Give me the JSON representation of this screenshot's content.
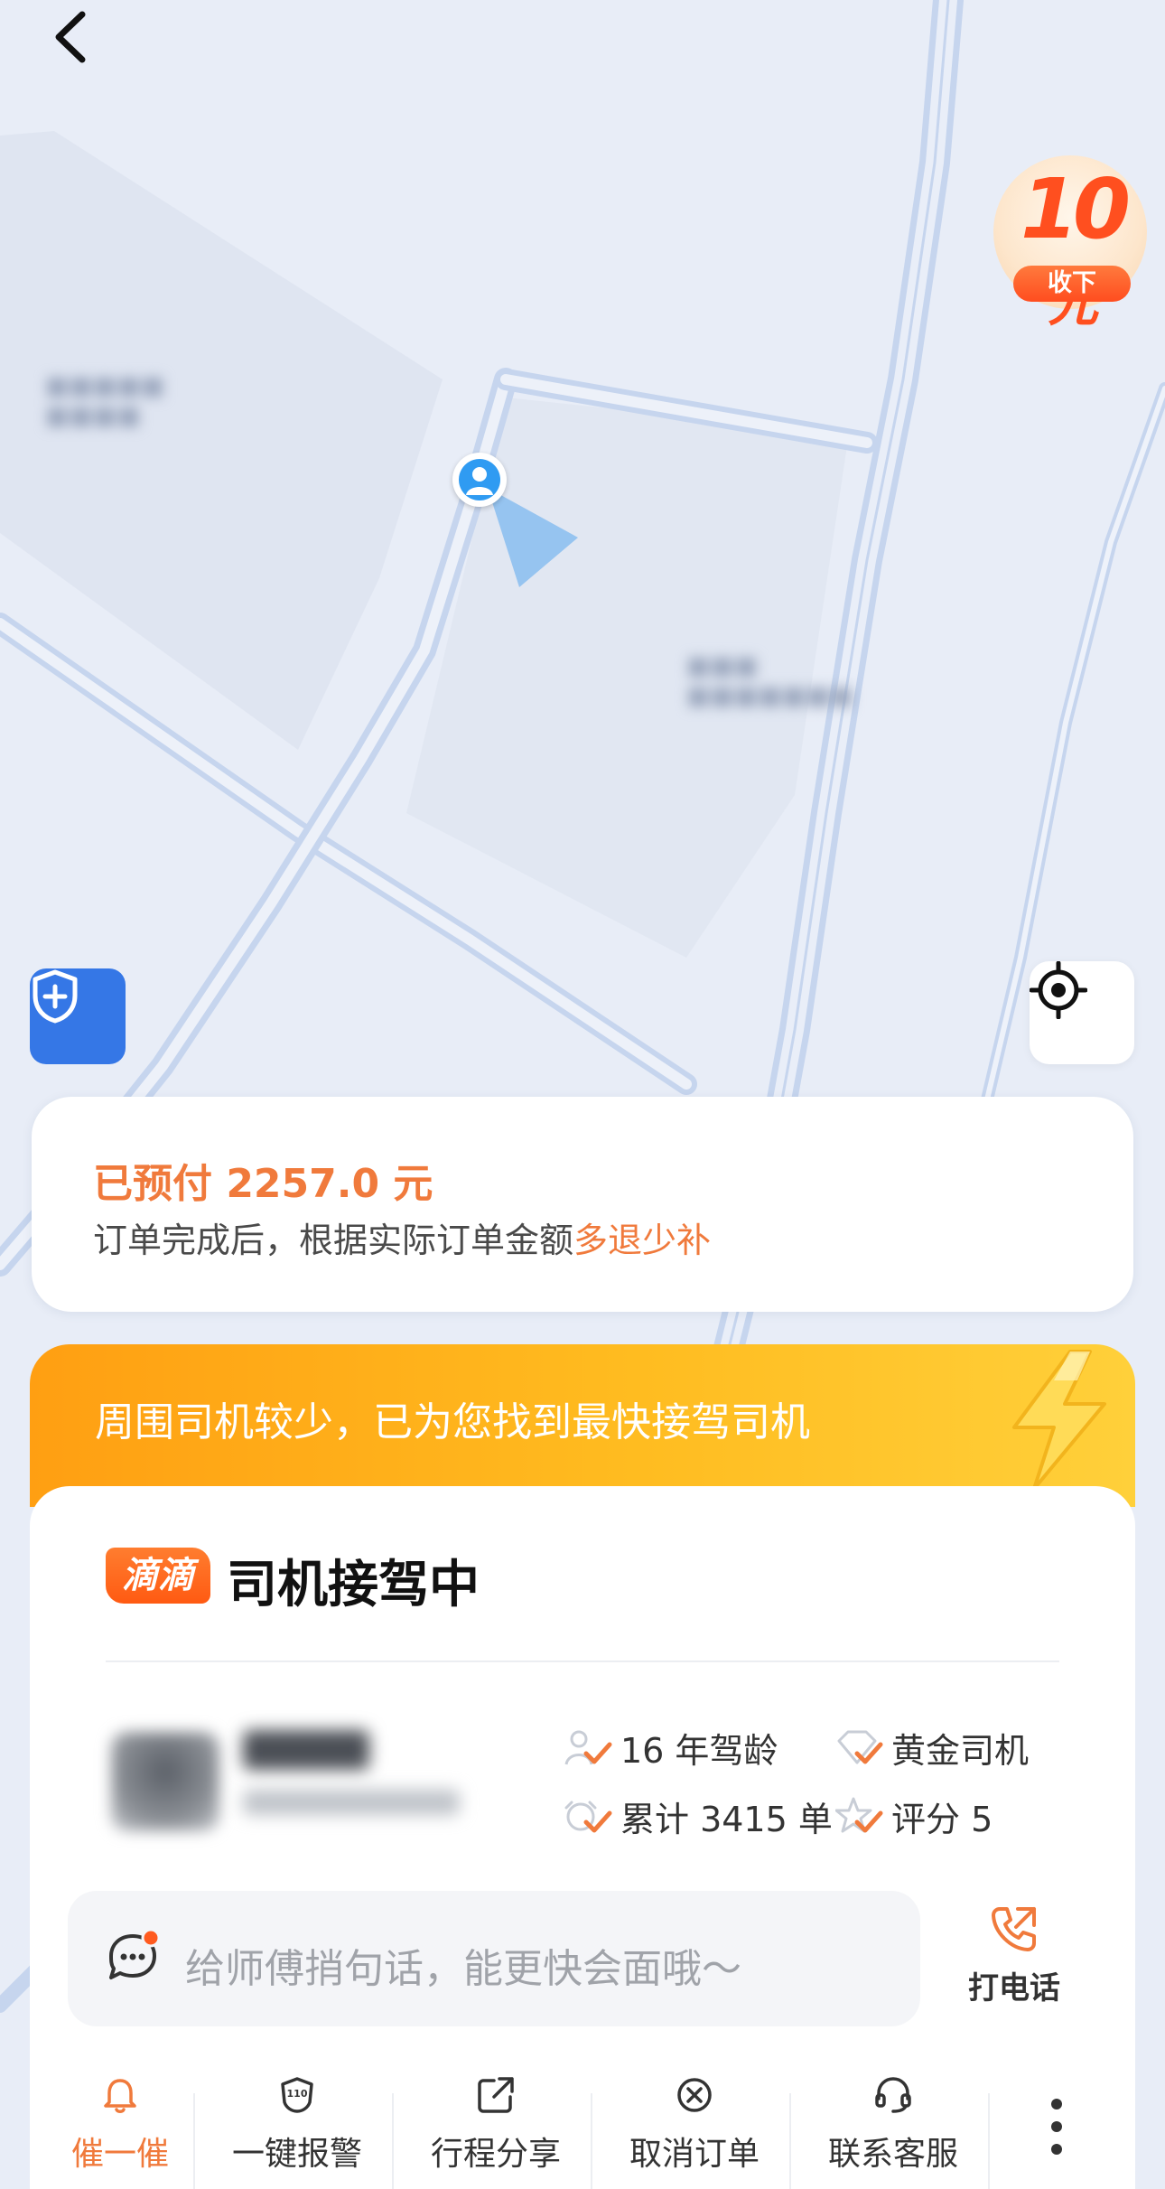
{
  "map": {
    "promo": {
      "amount": "10",
      "unit": "元",
      "action": "收下"
    }
  },
  "prepaid": {
    "amount_text": "已预付 2257.0 元",
    "note_prefix": "订单完成后，根据实际订单金额",
    "note_highlight": "多退少补"
  },
  "banner": {
    "text": "周围司机较少，已为您找到最快接驾司机"
  },
  "status": {
    "logo": "滴滴",
    "title": "司机接驾中"
  },
  "driver": {
    "stats": [
      {
        "label": "16 年驾龄",
        "icon": "driver-age-icon"
      },
      {
        "label": "黄金司机",
        "icon": "gold-badge-icon"
      },
      {
        "label": "累计 3415 单",
        "icon": "order-count-icon"
      },
      {
        "label": "评分 5",
        "icon": "rating-star-icon"
      }
    ]
  },
  "message": {
    "placeholder": "给师傅捎句话，能更快会面哦～"
  },
  "call": {
    "label": "打电话"
  },
  "actions": [
    {
      "label": "催一催",
      "icon": "bell-icon"
    },
    {
      "label": "一键报警",
      "icon": "police-110-icon"
    },
    {
      "label": "行程分享",
      "icon": "share-icon"
    },
    {
      "label": "取消订单",
      "icon": "cancel-circle-icon"
    },
    {
      "label": "联系客服",
      "icon": "headset-icon"
    }
  ],
  "colors": {
    "accent": "#f07a3c",
    "banner_start": "#ff9f12",
    "banner_end": "#ffd03a",
    "safety_blue": "#3577e6"
  }
}
